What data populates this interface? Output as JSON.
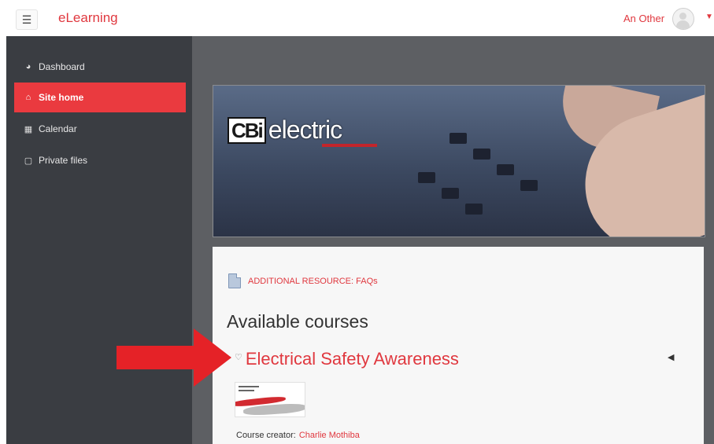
{
  "navbar": {
    "menu_icon": "hamburger-icon",
    "brand": "eLearning",
    "user_name": "An Other",
    "user_menu_icon": "caret-down-icon"
  },
  "sidebar": {
    "items": [
      {
        "label": "Dashboard",
        "icon": "tachometer-icon",
        "glyph": "◕",
        "active": false
      },
      {
        "label": "Site home",
        "icon": "home-icon",
        "glyph": "⌂",
        "active": true
      },
      {
        "label": "Calendar",
        "icon": "calendar-icon",
        "glyph": "▦",
        "active": false
      },
      {
        "label": "Private files",
        "icon": "file-icon",
        "glyph": "▢",
        "active": false
      }
    ]
  },
  "banner": {
    "logo_mark": "CBi",
    "logo_word": "electric"
  },
  "content": {
    "resource_link": "ADDITIONAL RESOURCE: FAQs",
    "section_heading": "Available courses",
    "course": {
      "title": "Electrical Safety Awareness",
      "creator_label": "Course creator:",
      "creator_name": "Charlie Mothiba"
    }
  },
  "colors": {
    "accent": "#e0383f",
    "sidebar_bg": "#3a3d42",
    "active_item": "#ea3a3f",
    "main_bg": "#5d5f63",
    "arrow": "#e52227"
  }
}
